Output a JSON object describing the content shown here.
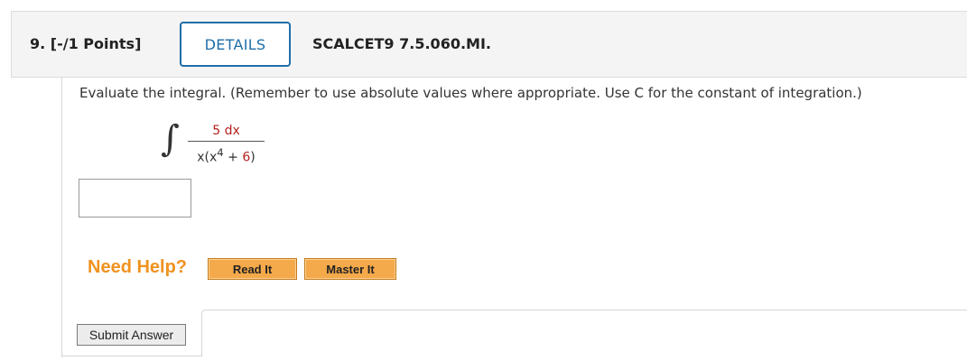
{
  "header": {
    "question_number": "9.",
    "points": "[-/1 Points]",
    "details_label": "DETAILS",
    "question_code": "SCALCET9 7.5.060.MI."
  },
  "question": {
    "prompt": "Evaluate the integral. (Remember to use absolute values where appropriate. Use C for the constant of integration.)",
    "integral_sign": "∫",
    "numerator": "5 dx",
    "denominator_prefix": "x(x",
    "denominator_exponent": "4",
    "denominator_plus": " + ",
    "denominator_constant": "6",
    "denominator_suffix": ")"
  },
  "answer": {
    "value": ""
  },
  "help": {
    "label": "Need Help?",
    "read_it_label": "Read It",
    "master_it_label": "Master It"
  },
  "submit": {
    "label": "Submit Answer"
  },
  "colors": {
    "accent": "#1f6ea8",
    "help": "#f0921f",
    "button": "#f4a94a",
    "highlight": "#b52020"
  }
}
